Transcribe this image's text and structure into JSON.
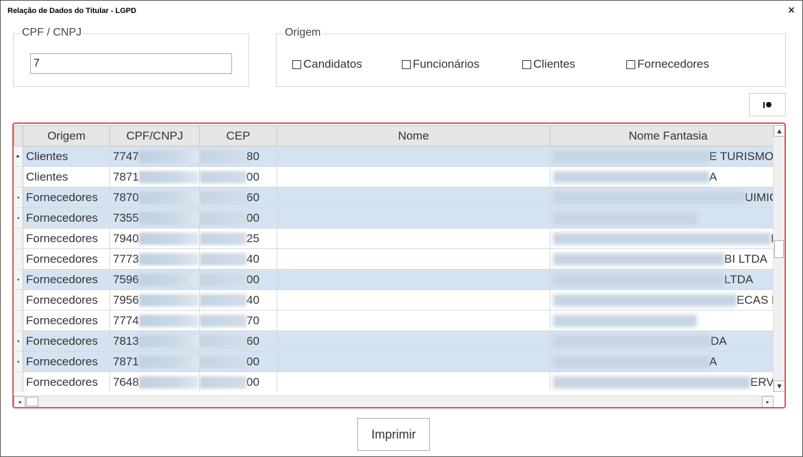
{
  "window": {
    "title": "Relação de Dados do Titular - LGPD",
    "close_glyph": "×"
  },
  "cpf_group": {
    "legend": "CPF / CNPJ",
    "value": "7"
  },
  "origem_group": {
    "legend": "Origem",
    "options": [
      {
        "label": "Candidatos",
        "checked": false
      },
      {
        "label": "Funcionários",
        "checked": false
      },
      {
        "label": "Clientes",
        "checked": false
      },
      {
        "label": "Fornecedores",
        "checked": false
      }
    ]
  },
  "toolbar": {
    "icon": "record-icon"
  },
  "grid": {
    "columns": [
      "Origem",
      "CPF/CNPJ",
      "CEP",
      "Nome",
      "Nome Fantasia"
    ],
    "rows": [
      {
        "indicator": "▸",
        "origem": "Clientes",
        "cpf": "7747",
        "cep": "80",
        "nome": "",
        "fantasia": "E TURISMO",
        "selected": true
      },
      {
        "indicator": "",
        "origem": "Clientes",
        "cpf": "7871",
        "cep": "00",
        "nome": "",
        "fantasia": "A",
        "selected": false
      },
      {
        "indicator": "•",
        "origem": "Fornecedores",
        "cpf": "7870",
        "cep": "60",
        "nome": "",
        "fantasia": "UIMICOS EI",
        "selected": true
      },
      {
        "indicator": "•",
        "origem": "Fornecedores",
        "cpf": "7355",
        "cep": "00",
        "nome": "",
        "fantasia": "",
        "selected": true
      },
      {
        "indicator": "",
        "origem": "Fornecedores",
        "cpf": "7940",
        "cep": "25",
        "nome": "",
        "fantasia": "PORTES LT",
        "selected": false
      },
      {
        "indicator": "",
        "origem": "Fornecedores",
        "cpf": "7773",
        "cep": "40",
        "nome": "",
        "fantasia": "BI LTDA",
        "selected": false
      },
      {
        "indicator": "•",
        "origem": "Fornecedores",
        "cpf": "7596",
        "cep": "00",
        "nome": "",
        "fantasia": "LTDA",
        "selected": true
      },
      {
        "indicator": "",
        "origem": "Fornecedores",
        "cpf": "7956",
        "cep": "40",
        "nome": "",
        "fantasia": "ECAS PARA",
        "selected": false
      },
      {
        "indicator": "",
        "origem": "Fornecedores",
        "cpf": "7774",
        "cep": "70",
        "nome": "",
        "fantasia": "",
        "selected": false
      },
      {
        "indicator": "•",
        "origem": "Fornecedores",
        "cpf": "7813",
        "cep": "60",
        "nome": "",
        "fantasia": "DA",
        "selected": true
      },
      {
        "indicator": "•",
        "origem": "Fornecedores",
        "cpf": "7871",
        "cep": "00",
        "nome": "",
        "fantasia": "A",
        "selected": true
      },
      {
        "indicator": "",
        "origem": "Fornecedores",
        "cpf": "7648",
        "cep": "00",
        "nome": "",
        "fantasia": "ERVICOS E C",
        "selected": false
      }
    ]
  },
  "scroll": {
    "up": "▲",
    "down": "▼",
    "left": "◂",
    "right": "▸"
  },
  "footer": {
    "print_label": "Imprimir"
  }
}
